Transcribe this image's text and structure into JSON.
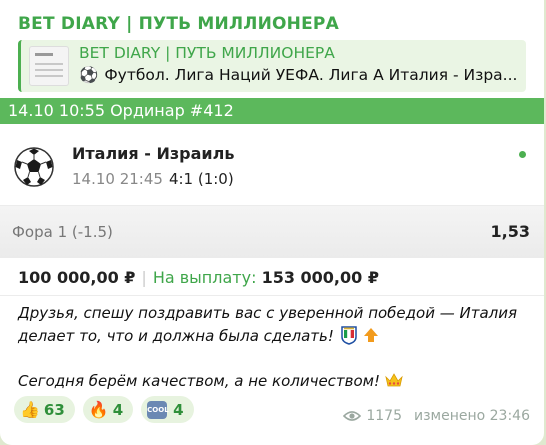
{
  "channel": {
    "name": "BET DIARY | ПУТЬ МИЛЛИОНЕРА"
  },
  "reply": {
    "title": "BET DIARY | ПУТЬ МИЛЛИОНЕРА",
    "ball_emoji": "⚽",
    "text": "Футбол. Лига Наций УЕФА. Лига А  Италия - Изра..."
  },
  "ticket": {
    "header": "14.10 10:55 Ординар  #412",
    "match": {
      "title": "Италия - Израиль",
      "time": "14.10 21:45",
      "score": "4:1 (1:0)"
    },
    "market": {
      "name": "Фора 1 (-1.5)",
      "odds": "1,53"
    },
    "stake": "100 000,00 ₽",
    "separator": "|",
    "payout_label": "На выплату:",
    "payout": "153 000,00 ₽"
  },
  "message": {
    "paragraph1": "Друзья, спешу поздравить вас с уверенной победой — Италия делает то, что и должна была сделать!",
    "paragraph2": "Сегодня берём качеством, а не количеством!"
  },
  "reactions": [
    {
      "emoji": "👍",
      "count": "63"
    },
    {
      "emoji": "🔥",
      "count": "4"
    },
    {
      "emoji": "COOL",
      "count": "4"
    }
  ],
  "footer": {
    "views": "1175",
    "edited": "изменено 23:46"
  },
  "colors": {
    "accent_green": "#3fa64a",
    "header_green": "#5cb85c",
    "background": "#dfe9cf"
  }
}
